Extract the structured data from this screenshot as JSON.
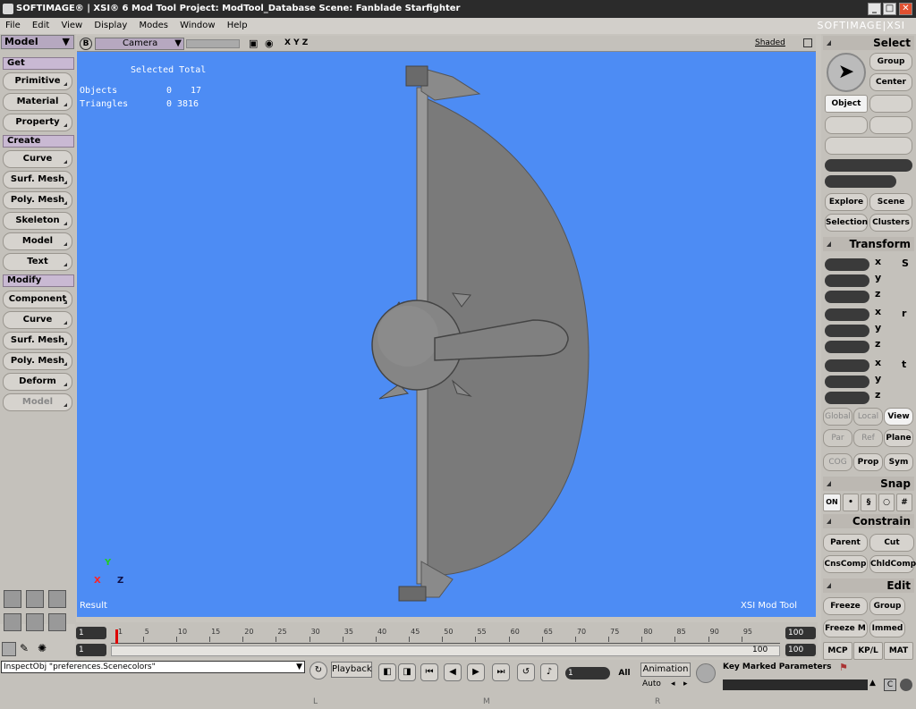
{
  "window": {
    "title": "SOFTIMAGE® | XSI® 6 Mod Tool Project: ModTool_Database    Scene: Fanblade Starfighter",
    "brand": "SOFTIMAGE|XSI",
    "min_label": "_",
    "max_label": "□",
    "close_label": "✕"
  },
  "menu": [
    "File",
    "Edit",
    "View",
    "Display",
    "Modes",
    "Window",
    "Help"
  ],
  "left_panel": {
    "mode": "Model",
    "sections": {
      "get": "Get",
      "create": "Create",
      "modify": "Modify"
    },
    "get_buttons": [
      "Primitive",
      "Material",
      "Property"
    ],
    "create_buttons": [
      "Curve",
      "Surf. Mesh",
      "Poly. Mesh",
      "Skeleton",
      "Model",
      "Text"
    ],
    "modify_buttons": [
      "Component",
      "Curve",
      "Surf. Mesh",
      "Poly. Mesh",
      "Deform",
      "Model"
    ]
  },
  "viewport": {
    "view_letter": "B",
    "camera": "Camera",
    "axes_label": "X Y Z",
    "shading": "Shaded",
    "stats_header": "Selected Total",
    "objects_label": "Objects",
    "objects_selected": "0",
    "objects_total": "17",
    "triangles_label": "Triangles",
    "triangles_selected": "0",
    "triangles_total": "3816",
    "result_label": "Result",
    "watermark": "XSI Mod Tool",
    "gizmo_x": "X",
    "gizmo_y": "Y",
    "gizmo_z": "Z"
  },
  "right_panel": {
    "select_title": "Select",
    "group": "Group",
    "center": "Center",
    "object": "Object",
    "explore": "Explore",
    "scene": "Scene",
    "selection": "Selection",
    "clusters": "Clusters",
    "transform_title": "Transform",
    "x": "x",
    "y": "y",
    "z": "z",
    "s": "S",
    "r": "r",
    "t": "t",
    "global": "Global",
    "local": "Local",
    "view": "View",
    "par": "Par",
    "ref": "Ref",
    "plane": "Plane",
    "cog": "COG",
    "prop": "Prop",
    "sym": "Sym",
    "snap_title": "Snap",
    "snap_on": "ON",
    "constrain_title": "Constrain",
    "parent": "Parent",
    "cut": "Cut",
    "cnscomp": "CnsComp",
    "chldcomp": "ChldComp",
    "edit_title": "Edit",
    "freeze": "Freeze",
    "edit_group": "Group",
    "freeze_m": "Freeze M",
    "immed": "Immed",
    "tab_mcp": "MCP",
    "tab_kpl": "KP/L",
    "tab_mat": "MAT"
  },
  "timeline": {
    "start": "1",
    "start2": "1",
    "end": "100",
    "end2": "100",
    "ticks": [
      "1",
      "5",
      "10",
      "15",
      "20",
      "25",
      "30",
      "35",
      "40",
      "45",
      "50",
      "55",
      "60",
      "65",
      "70",
      "75",
      "80",
      "85",
      "90",
      "95"
    ],
    "current_frame": 1
  },
  "bottom": {
    "command": "InspectObj \"preferences.Scenecolors\"",
    "playback": "Playback",
    "frame_value": "1",
    "all": "All",
    "animation": "Animation",
    "auto": "Auto",
    "key_marked": "Key Marked Parameters",
    "mouse_l": "L",
    "mouse_m": "M",
    "mouse_r": "R"
  },
  "colors": {
    "viewport_bg": "#4d8cf4",
    "model_grey": "#7a7a7a",
    "section_purple": "#c9b9d3"
  }
}
